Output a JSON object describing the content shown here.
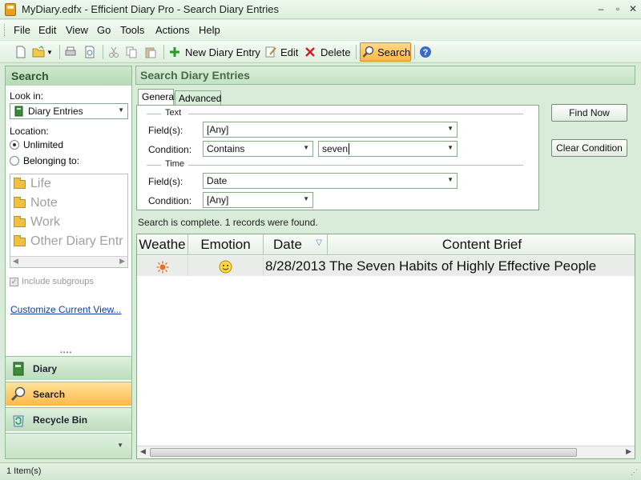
{
  "window": {
    "title": "MyDiary.edfx - Efficient Diary Pro - Search Diary Entries"
  },
  "menu": {
    "items": [
      "File",
      "Edit",
      "View",
      "Go",
      "Tools",
      "Actions",
      "Help"
    ]
  },
  "toolbar": {
    "new_entry": "New Diary Entry",
    "edit": "Edit",
    "delete": "Delete",
    "search": "Search"
  },
  "left": {
    "header": "Search",
    "look_in_label": "Look in:",
    "look_in_value": "Diary Entries",
    "location_label": "Location:",
    "radio_unlimited": "Unlimited",
    "radio_belonging": "Belonging to:",
    "groups": [
      "Life",
      "Note",
      "Work",
      "Other Diary Entr"
    ],
    "include_subgroups": "Include subgroups",
    "customize_link": "Customize Current View...",
    "nav": [
      "Diary",
      "Search",
      "Recycle Bin"
    ]
  },
  "right": {
    "header": "Search Diary Entries",
    "tabs": [
      "General",
      "Advanced"
    ],
    "text_section": "Text",
    "text_fields_label": "Field(s):",
    "text_fields_value": "[Any]",
    "text_condition_label": "Condition:",
    "text_condition_value": "Contains",
    "text_search_value": "seven",
    "time_section": "Time",
    "time_fields_label": "Field(s):",
    "time_fields_value": "Date",
    "time_condition_label": "Condition:",
    "time_condition_value": "[Any]",
    "find_now": "Find Now",
    "clear_condition": "Clear Condition",
    "status": "Search is complete. 1 records were found."
  },
  "grid": {
    "columns": [
      "Weathe",
      "Emotion",
      "Date",
      "Content Brief"
    ],
    "rows": [
      {
        "weather_icon": "sun-icon",
        "emotion_icon": "smiley-icon",
        "date": "8/28/2013",
        "brief": "The Seven Habits of Highly Effective People"
      }
    ]
  },
  "statusbar": {
    "text": "1 Item(s)"
  }
}
